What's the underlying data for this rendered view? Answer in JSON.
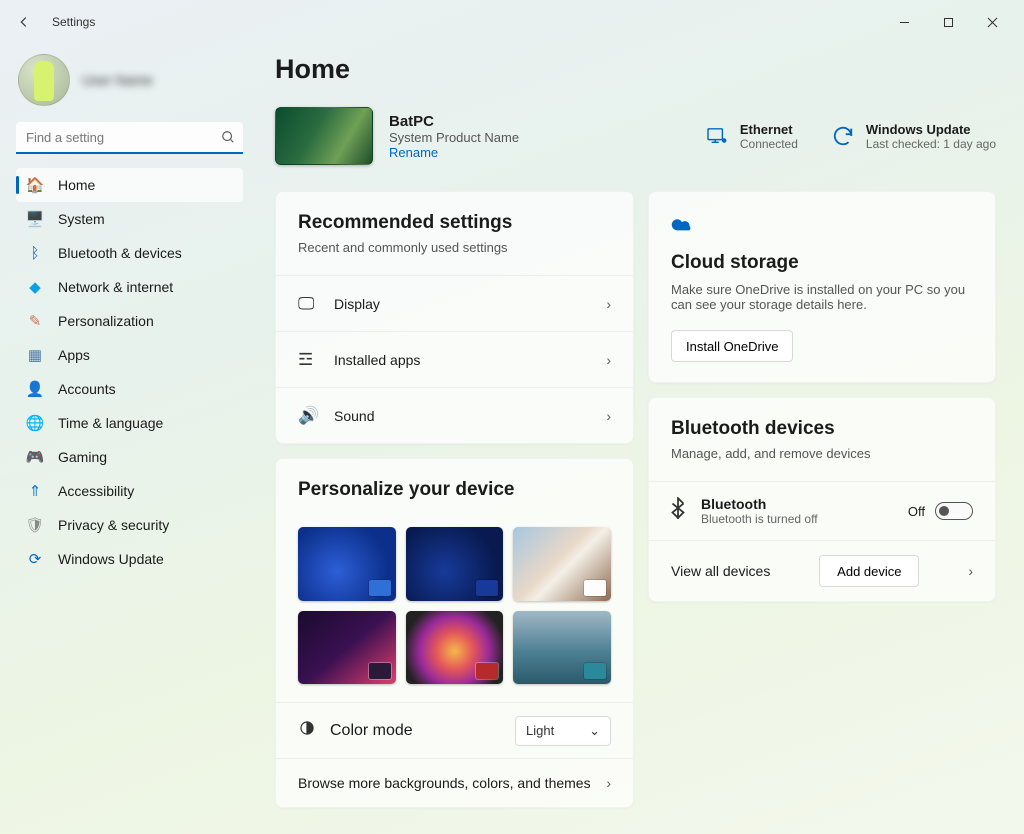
{
  "app": {
    "title": "Settings"
  },
  "profile": {
    "name": "User Name"
  },
  "search": {
    "placeholder": "Find a setting"
  },
  "nav": [
    {
      "label": "Home",
      "icon": "🏠",
      "selected": true
    },
    {
      "label": "System",
      "icon": "🖥️"
    },
    {
      "label": "Bluetooth & devices",
      "icon": "ᛒ",
      "iconColor": "#0067c0"
    },
    {
      "label": "Network & internet",
      "icon": "◆",
      "iconColor": "#0aa0e6"
    },
    {
      "label": "Personalization",
      "icon": "✎",
      "iconColor": "#d07050"
    },
    {
      "label": "Apps",
      "icon": "▦",
      "iconColor": "#4a78a8"
    },
    {
      "label": "Accounts",
      "icon": "👤",
      "iconColor": "#2aa06a"
    },
    {
      "label": "Time & language",
      "icon": "🌐",
      "iconColor": "#3a88c0"
    },
    {
      "label": "Gaming",
      "icon": "🎮",
      "iconColor": "#888"
    },
    {
      "label": "Accessibility",
      "icon": "⇑",
      "iconColor": "#0078d4"
    },
    {
      "label": "Privacy & security",
      "icon": "🛡",
      "iconColor": "#888"
    },
    {
      "label": "Windows Update",
      "icon": "⟳",
      "iconColor": "#0067c0"
    }
  ],
  "page": {
    "title": "Home"
  },
  "device": {
    "name": "BatPC",
    "sub": "System Product Name",
    "rename": "Rename"
  },
  "status": {
    "eth": {
      "title": "Ethernet",
      "sub": "Connected"
    },
    "wu": {
      "title": "Windows Update",
      "sub": "Last checked: 1 day ago"
    }
  },
  "rec": {
    "title": "Recommended settings",
    "sub": "Recent and commonly used settings",
    "items": [
      {
        "label": "Display",
        "icon": "🖵"
      },
      {
        "label": "Installed apps",
        "icon": "☲"
      },
      {
        "label": "Sound",
        "icon": "🔊"
      }
    ]
  },
  "personalize": {
    "title": "Personalize your device",
    "color_mode_label": "Color mode",
    "color_mode_value": "Light",
    "more": "Browse more backgrounds, colors, and themes",
    "themes": [
      {
        "bg": "radial-gradient(circle at 40% 60%, #2e5fd8, #0b2f8a 70%)",
        "sw": "#2e6fd8"
      },
      {
        "bg": "radial-gradient(circle at 40% 60%, #173a9a, #081a50 70%)",
        "sw": "#173a9a"
      },
      {
        "bg": "linear-gradient(135deg,#a7c7e0 0%,#e8d8c8 45%,#f4efe7 55%,#8c6a4f 100%)",
        "sw": "#fdfdfd"
      },
      {
        "bg": "linear-gradient(140deg,#1a0b2e 0%,#3a1052 50%,#d23a6a 95%)",
        "sw": "#2a1a3a",
        "dark": true
      },
      {
        "bg": "radial-gradient(circle at 50% 55%, #f6b84a 0%, #e2555b 30%, #9a2a9a 55%, #222 80%)",
        "sw": "#b82a2a",
        "dark": true
      },
      {
        "bg": "linear-gradient(180deg,#a1b8c4 0%,#4e8195 55%,#2a5a6a 100%)",
        "sw": "#2a8a9a"
      }
    ]
  },
  "cloud": {
    "title": "Cloud storage",
    "desc": "Make sure OneDrive is installed on your PC so you can see your storage details here.",
    "btn": "Install OneDrive"
  },
  "bt": {
    "title": "Bluetooth devices",
    "sub": "Manage, add, and remove devices",
    "row_title": "Bluetooth",
    "row_sub": "Bluetooth is turned off",
    "toggle_state": "Off",
    "view_all": "View all devices",
    "add": "Add device"
  }
}
